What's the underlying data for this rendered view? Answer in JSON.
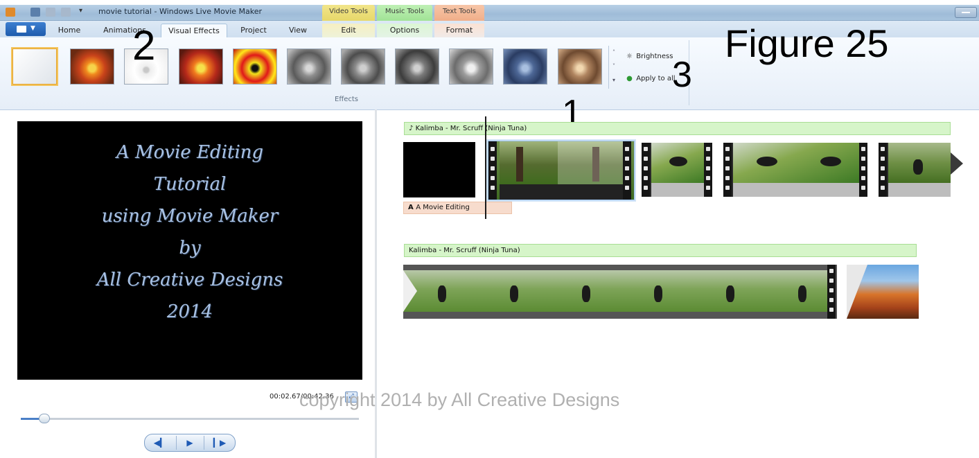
{
  "window": {
    "title": "movie tutorial - Windows Live Movie Maker"
  },
  "context_tabs": {
    "video": "Video Tools",
    "music": "Music Tools",
    "text": "Text Tools"
  },
  "tabs": {
    "home": "Home",
    "animations": "Animations",
    "visual_effects": "Visual Effects",
    "project": "Project",
    "view": "View",
    "edit": "Edit",
    "options": "Options",
    "format": "Format"
  },
  "ribbon": {
    "brightness_label": "Brightness",
    "apply_all_label": "Apply to all",
    "group_label": "Effects"
  },
  "annotations": {
    "fig": "Figure 25",
    "n1": "1",
    "n2": "2",
    "n3": "3"
  },
  "preview": {
    "lines": [
      "A Movie Editing",
      "Tutorial",
      "using Movie Maker",
      "by",
      "All Creative Designs",
      "2014"
    ],
    "time": "00:02.67/00:42.36",
    "seek_position": 0.07
  },
  "storyboard": {
    "music_track_1": "Kalimba - Mr. Scruff (Ninja Tuna)",
    "music_track_2": "Kalimba - Mr. Scruff (Ninja Tuna)",
    "caption": "A Movie Editing"
  },
  "watermark": "copyright 2014 by All Creative Designs",
  "colors": {
    "accent": "#1f5cad",
    "music_bar": "#d6f5c9",
    "caption_bar": "#f7dccd",
    "preview_text": "#a9c2e4"
  }
}
